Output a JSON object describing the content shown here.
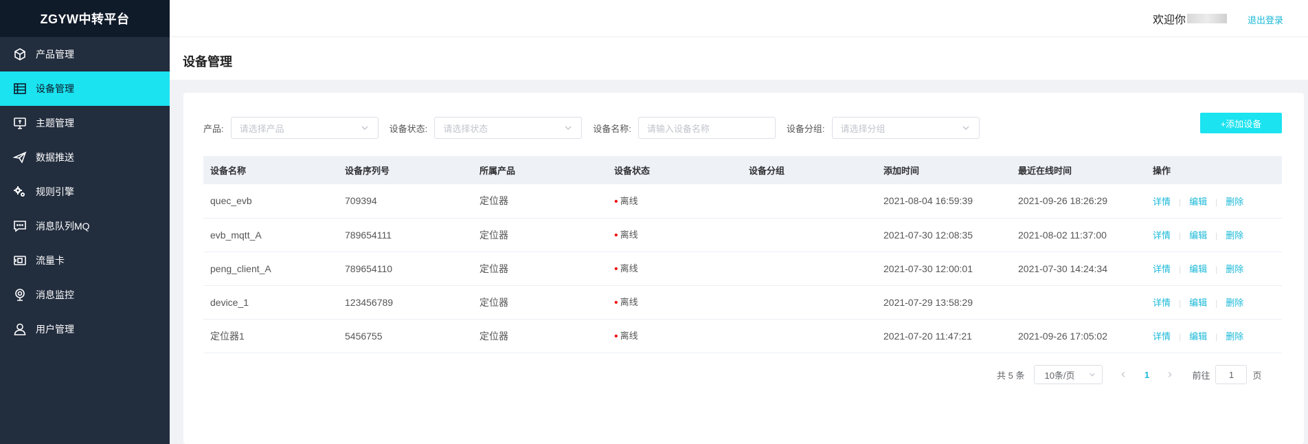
{
  "brand": "ZGYW中转平台",
  "sidebar": {
    "items": [
      {
        "label": "产品管理",
        "icon": "cube-icon",
        "active": false
      },
      {
        "label": "设备管理",
        "icon": "grid-list-icon",
        "active": true
      },
      {
        "label": "主题管理",
        "icon": "topic-monitor-icon",
        "active": false
      },
      {
        "label": "数据推送",
        "icon": "send-plane-icon",
        "active": false
      },
      {
        "label": "规则引擎",
        "icon": "gears-icon",
        "active": false
      },
      {
        "label": "消息队列MQ",
        "icon": "message-icon",
        "active": false
      },
      {
        "label": "流量卡",
        "icon": "sim-card-icon",
        "active": false
      },
      {
        "label": "消息监控",
        "icon": "webcam-icon",
        "active": false
      },
      {
        "label": "用户管理",
        "icon": "user-icon",
        "active": false
      }
    ]
  },
  "header": {
    "welcome": "欢迎你",
    "logout": "退出登录"
  },
  "page": {
    "title": "设备管理"
  },
  "filters": {
    "product_label": "产品:",
    "product_placeholder": "请选择产品",
    "status_label": "设备状态:",
    "status_placeholder": "请选择状态",
    "name_label": "设备名称:",
    "name_placeholder": "请输入设备名称",
    "group_label": "设备分组:",
    "group_placeholder": "请选择分组",
    "add_button": "+添加设备"
  },
  "table": {
    "headers": [
      "设备名称",
      "设备序列号",
      "所属产品",
      "设备状态",
      "设备分组",
      "添加时间",
      "最近在线时间",
      "操作"
    ],
    "rows": [
      {
        "name": "quec_evb",
        "serial": "709394",
        "product": "定位器",
        "status": "离线",
        "group": "",
        "added": "2021-08-04 16:59:39",
        "last_online": "2021-09-26 18:26:29"
      },
      {
        "name": "evb_mqtt_A",
        "serial": "789654111",
        "product": "定位器",
        "status": "离线",
        "group": "",
        "added": "2021-07-30 12:08:35",
        "last_online": "2021-08-02 11:37:00"
      },
      {
        "name": "peng_client_A",
        "serial": "789654110",
        "product": "定位器",
        "status": "离线",
        "group": "",
        "added": "2021-07-30 12:00:01",
        "last_online": "2021-07-30 14:24:34"
      },
      {
        "name": "device_1",
        "serial": "123456789",
        "product": "定位器",
        "status": "离线",
        "group": "",
        "added": "2021-07-29 13:58:29",
        "last_online": ""
      },
      {
        "name": "定位器1",
        "serial": "5456755",
        "product": "定位器",
        "status": "离线",
        "group": "",
        "added": "2021-07-20 11:47:21",
        "last_online": "2021-09-26 17:05:02"
      }
    ],
    "actions": {
      "detail": "详情",
      "edit": "编辑",
      "delete": "删除"
    }
  },
  "pagination": {
    "total": "共 5 条",
    "page_size": "10条/页",
    "current_page": "1",
    "goto_label": "前往",
    "goto_value": "1",
    "page_suffix": "页"
  },
  "colors": {
    "accent": "#1be3f0",
    "link": "#1bb9d8",
    "sidebar": "#222d3e",
    "brand_bg": "#101b2a",
    "offline_dot": "#e11111"
  }
}
